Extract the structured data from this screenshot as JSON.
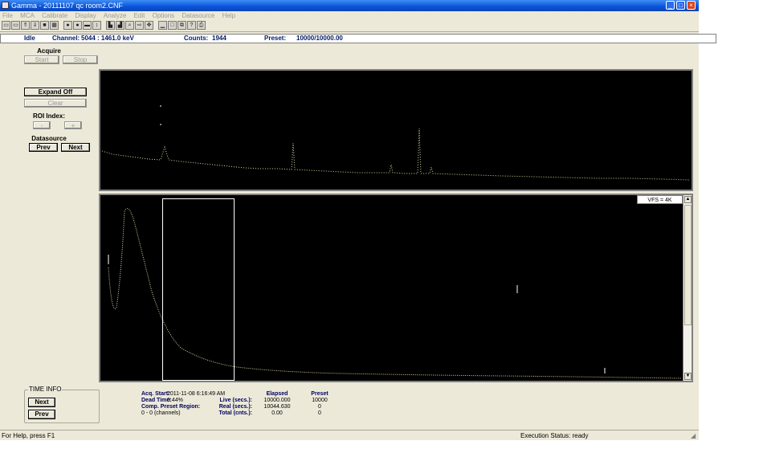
{
  "window": {
    "title": "Gamma - 20111107 qc room2.CNF"
  },
  "menu": [
    "File",
    "MCA",
    "Calibrate",
    "Display",
    "Analyze",
    "Edit",
    "Options",
    "Datasource",
    "Help"
  ],
  "status_row": {
    "state": "Idle",
    "channel_label": "Channel:",
    "channel_value": "5044 : 1461.0 keV",
    "counts_label": "Counts:",
    "counts_value": "1944",
    "preset_label": "Preset:",
    "preset_value": "10000/10000.00"
  },
  "left_panel": {
    "acquire_label": "Acquire",
    "start_label": "Start",
    "stop_label": "Stop",
    "expand_label": "Expand Off",
    "clear_label": "Clear",
    "roi_label": "ROI Index:",
    "roi_prev": "-",
    "roi_next": "+",
    "datasource_label": "Datasource",
    "prev_label": "Prev",
    "next_label": "Next"
  },
  "plot": {
    "vfs_label": "VFS = 4K"
  },
  "time_info": {
    "title": "TIME INFO",
    "next_label": "Next",
    "prev_label": "Prev",
    "acq_start_label": "Acq. Start:",
    "acq_start_value": "2011-11-08 6:16:49 AM",
    "dead_time_label": "Dead Time:",
    "dead_time_value": "0.44%",
    "comp_preset_label": "Comp. Preset Region:",
    "channels_value": "0 - 0 (channels)",
    "col_elapsed": "Elapsed",
    "col_preset": "Preset",
    "live_label": "Live (secs.):",
    "live_elapsed": "10000.000",
    "live_preset": "10000",
    "real_label": "Real (secs.):",
    "real_elapsed": "10044.630",
    "real_preset": "0",
    "total_label": "Total (cnts.):",
    "total_elapsed": "0.00",
    "total_preset": "0"
  },
  "statusbar": {
    "help_text": "For Help, press F1",
    "execution_status": "Execution Status: ready"
  }
}
